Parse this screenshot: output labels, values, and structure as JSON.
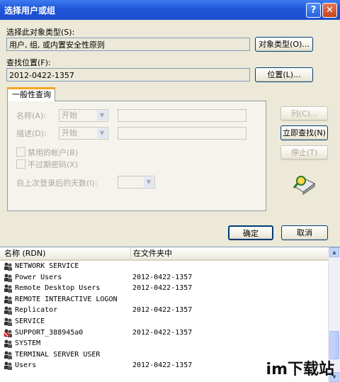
{
  "window": {
    "title": "选择用户或组",
    "help_label": "?",
    "close_label": "✕"
  },
  "object_type": {
    "label": "选择此对象类型(S):",
    "value": "用户, 组, 或内置安全性原则",
    "button": "对象类型(O)..."
  },
  "location": {
    "label": "查找位置(F):",
    "value": "2012-0422-1357",
    "button": "位置(L)..."
  },
  "tab": {
    "label": "一般性查询"
  },
  "query": {
    "name_label": "名称(A):",
    "name_mode": "开始",
    "desc_label": "描述(D):",
    "desc_mode": "开始",
    "disabled_accounts": "禁用的帐户(B)",
    "no_expire_pwd": "不过期密码(X)",
    "days_label": "自上次登录后的天数(I):"
  },
  "side_buttons": {
    "columns": "列(C)...",
    "find_now": "立即查找(N)",
    "stop": "停止(T)"
  },
  "ok": "确定",
  "cancel": "取消",
  "results": {
    "col_name": "名称 (RDN)",
    "col_folder": "在文件夹中",
    "rows": [
      {
        "name": "NETWORK SERVICE",
        "folder": ""
      },
      {
        "name": "Power Users",
        "folder": "2012-0422-1357"
      },
      {
        "name": "Remote Desktop Users",
        "folder": "2012-0422-1357"
      },
      {
        "name": "REMOTE INTERACTIVE LOGON",
        "folder": ""
      },
      {
        "name": "Replicator",
        "folder": "2012-0422-1357"
      },
      {
        "name": "SERVICE",
        "folder": ""
      },
      {
        "name": "SUPPORT_388945a0",
        "folder": "2012-0422-1357"
      },
      {
        "name": "SYSTEM",
        "folder": ""
      },
      {
        "name": "TERMINAL SERVER USER",
        "folder": ""
      },
      {
        "name": "Users",
        "folder": "2012-0422-1357"
      }
    ]
  },
  "watermark": "im下载站",
  "colors": {
    "titlebar": "#1f56d8",
    "tab_accent": "#f5a623"
  }
}
